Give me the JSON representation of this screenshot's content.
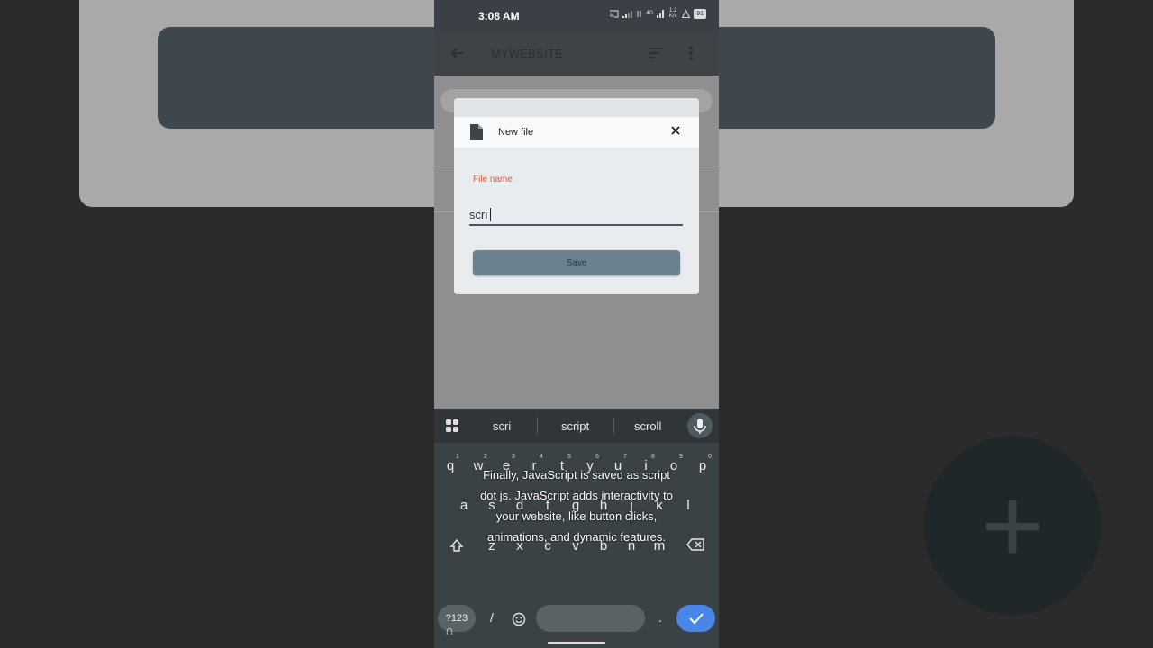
{
  "status": {
    "time": "3:08 AM",
    "speed": "1.2 K/s",
    "battery": "91",
    "network": "4G"
  },
  "appbar": {
    "title": "MYWEBSITE"
  },
  "dialog": {
    "title": "New file",
    "field_label": "File name",
    "field_value": "scri",
    "save_label": "Save"
  },
  "fab": {
    "icon": "plus-icon"
  },
  "keyboard": {
    "suggestions": [
      "scri",
      "script",
      "scroll"
    ],
    "row1": [
      "q",
      "w",
      "e",
      "r",
      "t",
      "y",
      "u",
      "i",
      "o",
      "p"
    ],
    "row1_numbers": [
      "1",
      "2",
      "3",
      "4",
      "5",
      "6",
      "7",
      "8",
      "9",
      "0"
    ],
    "row2": [
      "a",
      "s",
      "d",
      "f",
      "g",
      "h",
      "j",
      "k",
      "l"
    ],
    "row3": [
      "z",
      "x",
      "c",
      "v",
      "b",
      "n",
      "m"
    ],
    "symbols_label": "?123",
    "slash": "/",
    "period": "."
  },
  "caption": {
    "lines": [
      "Finally, JavaScript is saved as script",
      "dot js. JavaScript adds interactivity to",
      "your website, like button clicks,",
      "animations, and dynamic features."
    ]
  },
  "colors": {
    "accent": "#4a86e8",
    "label": "#d0624a",
    "save_button": "#6d8290"
  }
}
